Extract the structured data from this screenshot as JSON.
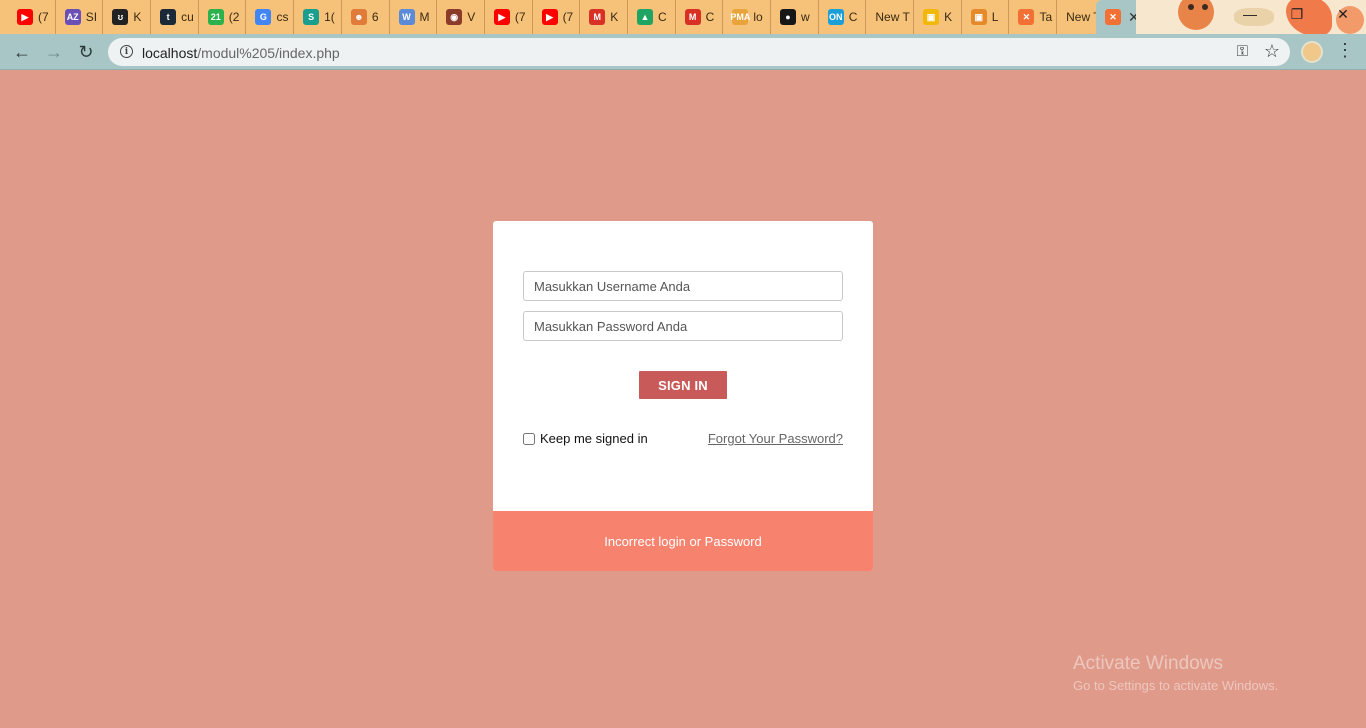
{
  "browser": {
    "tabs": [
      {
        "icon": "youtube-icon",
        "text": "(7",
        "color": "#ff0000",
        "glyph": "▶"
      },
      {
        "icon": "az-icon",
        "text": "SI",
        "color": "#6a4fb5",
        "glyph": "AZ"
      },
      {
        "icon": "notes-icon",
        "text": "K",
        "color": "#222222",
        "glyph": "ʊ"
      },
      {
        "icon": "tumblr-icon",
        "text": "cu",
        "color": "#1b2838",
        "glyph": "t"
      },
      {
        "icon": "counter-icon",
        "text": "(2",
        "color": "#2bb24c",
        "glyph": "21"
      },
      {
        "icon": "google-icon",
        "text": "cs",
        "color": "#4285f4",
        "glyph": "G"
      },
      {
        "icon": "s-icon",
        "text": "1(",
        "color": "#1a9e8e",
        "glyph": "S"
      },
      {
        "icon": "avatar-icon",
        "text": "6",
        "color": "#e07b39",
        "glyph": "☻"
      },
      {
        "icon": "wordpress-icon",
        "text": "M",
        "color": "#5b8bd6",
        "glyph": "W"
      },
      {
        "icon": "photo-icon",
        "text": "V",
        "color": "#8a3b2a",
        "glyph": "◉"
      },
      {
        "icon": "youtube-icon",
        "text": "(7",
        "color": "#ff0000",
        "glyph": "▶"
      },
      {
        "icon": "youtube-icon",
        "text": "(7",
        "color": "#ff0000",
        "glyph": "▶"
      },
      {
        "icon": "gmail-icon",
        "text": "K",
        "color": "#d93025",
        "glyph": "M"
      },
      {
        "icon": "drive-icon",
        "text": "C",
        "color": "#1fa463",
        "glyph": "▲"
      },
      {
        "icon": "gmail-icon",
        "text": "C",
        "color": "#d93025",
        "glyph": "M"
      },
      {
        "icon": "pma-icon",
        "text": "lo",
        "color": "#e8a33a",
        "glyph": "PMA"
      },
      {
        "icon": "github-icon",
        "text": "w",
        "color": "#181717",
        "glyph": "●"
      },
      {
        "icon": "on-icon",
        "text": "C",
        "color": "#1a9fd6",
        "glyph": "ON"
      },
      {
        "icon": "blank-icon",
        "text": "New T",
        "color": "",
        "glyph": ""
      },
      {
        "icon": "classroom-icon",
        "text": "K",
        "color": "#f2b807",
        "glyph": "▣"
      },
      {
        "icon": "contact-icon",
        "text": "L",
        "color": "#e58a2b",
        "glyph": "▣"
      },
      {
        "icon": "xampp-icon",
        "text": "Ta",
        "color": "#f27034",
        "glyph": "✕"
      },
      {
        "icon": "blank-icon",
        "text": "New T",
        "color": "",
        "glyph": ""
      }
    ],
    "active_tab": {
      "icon": "xampp-icon",
      "color": "#f27034",
      "glyph": "✕"
    },
    "url_host": "localhost",
    "url_path": "/modul%205/index.php"
  },
  "login": {
    "username_placeholder": "Masukkan Username Anda",
    "password_placeholder": "Masukkan Password Anda",
    "signin_label": "SIGN IN",
    "remember_label": "Keep me signed in",
    "forgot_label": "Forgot Your Password?",
    "error_message": "Incorrect login or Password"
  },
  "watermark": {
    "title": "Activate Windows",
    "subtitle": "Go to Settings to activate Windows."
  },
  "colors": {
    "page_bg": "#df9a8a",
    "signin_bg": "#c95a5a",
    "error_bg": "#f7836f",
    "toolbar_bg": "#a8c6c6",
    "tabstrip_bg": "#f6c27a"
  }
}
